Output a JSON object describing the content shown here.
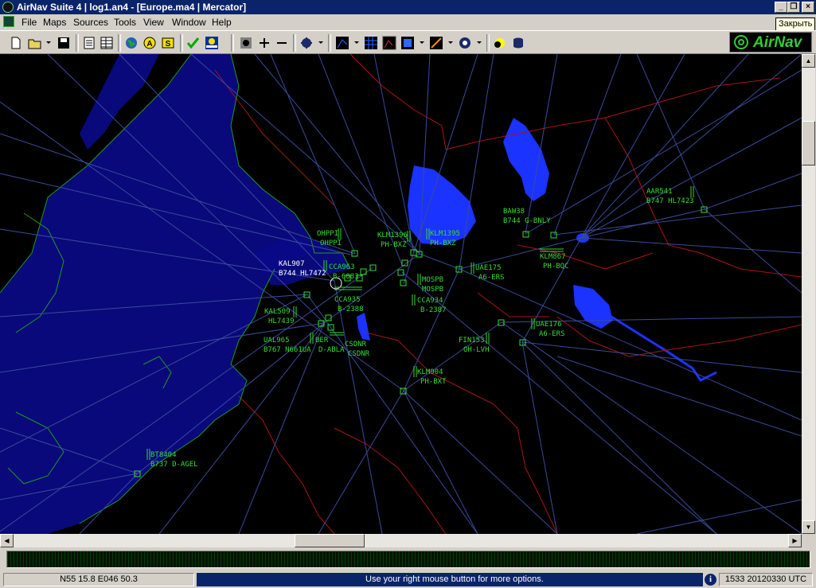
{
  "window": {
    "title": "AirNav Suite 4 | log1.an4 - [Europe.ma4 | Mercator]"
  },
  "menu": [
    "File",
    "Maps",
    "Sources",
    "Tools",
    "View",
    "Window",
    "Help"
  ],
  "tooltip": "Закрыть",
  "logo": "AirNav",
  "toolbar": {
    "icons": [
      "new-file-icon",
      "open-folder-icon",
      "save-icon",
      "list-icon",
      "grid-list-icon",
      "globe-icon",
      "label-a-icon",
      "label-s-icon",
      "checkmark-icon",
      "airport-icon",
      "zoom-fit-icon",
      "zoom-in-icon",
      "zoom-out-icon",
      "aircraft-filter-icon",
      "map-layer-icon",
      "grid-icon",
      "radar-icon",
      "color-icon",
      "route-icon",
      "compass-icon",
      "sun-icon",
      "database-icon"
    ]
  },
  "colors": {
    "map_bg": "#000000",
    "water": "#0000aa",
    "lake": "#1a33ff",
    "border": "#aa1414",
    "route": "#3a4a9a",
    "label_green": "#33dd33",
    "label_white": "#ffffff"
  },
  "flights": [
    {
      "callsign": "OHPPI",
      "detail": "OHPPI",
      "color": "green"
    },
    {
      "callsign": "KLM1396",
      "detail": "PH-BXZ",
      "color": "green"
    },
    {
      "callsign": "KLM1395",
      "detail": "PH-BXZ",
      "color": "green"
    },
    {
      "callsign": "BAW38",
      "detail": "B744 G-BNLY",
      "color": "green"
    },
    {
      "callsign": "AAR541",
      "detail": "B747 HL7423",
      "color": "green"
    },
    {
      "callsign": "KAL907",
      "detail": "B744 HL7472",
      "color": "white"
    },
    {
      "callsign": "CCA963",
      "detail": "B-6083",
      "color": "green"
    },
    {
      "callsign": "MOSPB",
      "detail": "MOSPB",
      "color": "green"
    },
    {
      "callsign": "UAE175",
      "detail": "A6-ERS",
      "color": "green"
    },
    {
      "callsign": "KLM867",
      "detail": "PH-BQC",
      "color": "green"
    },
    {
      "callsign": "CCA935",
      "detail": "B-2388",
      "color": "green"
    },
    {
      "callsign": "CCA934",
      "detail": "B-2387",
      "color": "green"
    },
    {
      "callsign": "KAL509",
      "detail": "HL7439",
      "color": "green"
    },
    {
      "callsign": "UAL965",
      "detail": "B767 N661UA",
      "color": "green"
    },
    {
      "callsign": "BER",
      "detail": "D-ABLA",
      "color": "green"
    },
    {
      "callsign": "CSDNR",
      "detail": "CSDNR",
      "color": "green"
    },
    {
      "callsign": "UAE176",
      "detail": "A6-ERS",
      "color": "green"
    },
    {
      "callsign": "FIN153",
      "detail": "OH-LVH",
      "color": "green"
    },
    {
      "callsign": "KLM904",
      "detail": "PH-BXT",
      "color": "green"
    },
    {
      "callsign": "BT8404",
      "detail": "B737 D-AGEL",
      "color": "green"
    }
  ],
  "status": {
    "coordinates": "N55 15.8 E046 50.3",
    "message": "Use your right mouse button for more options.",
    "time": "1533 20120330 UTC"
  }
}
